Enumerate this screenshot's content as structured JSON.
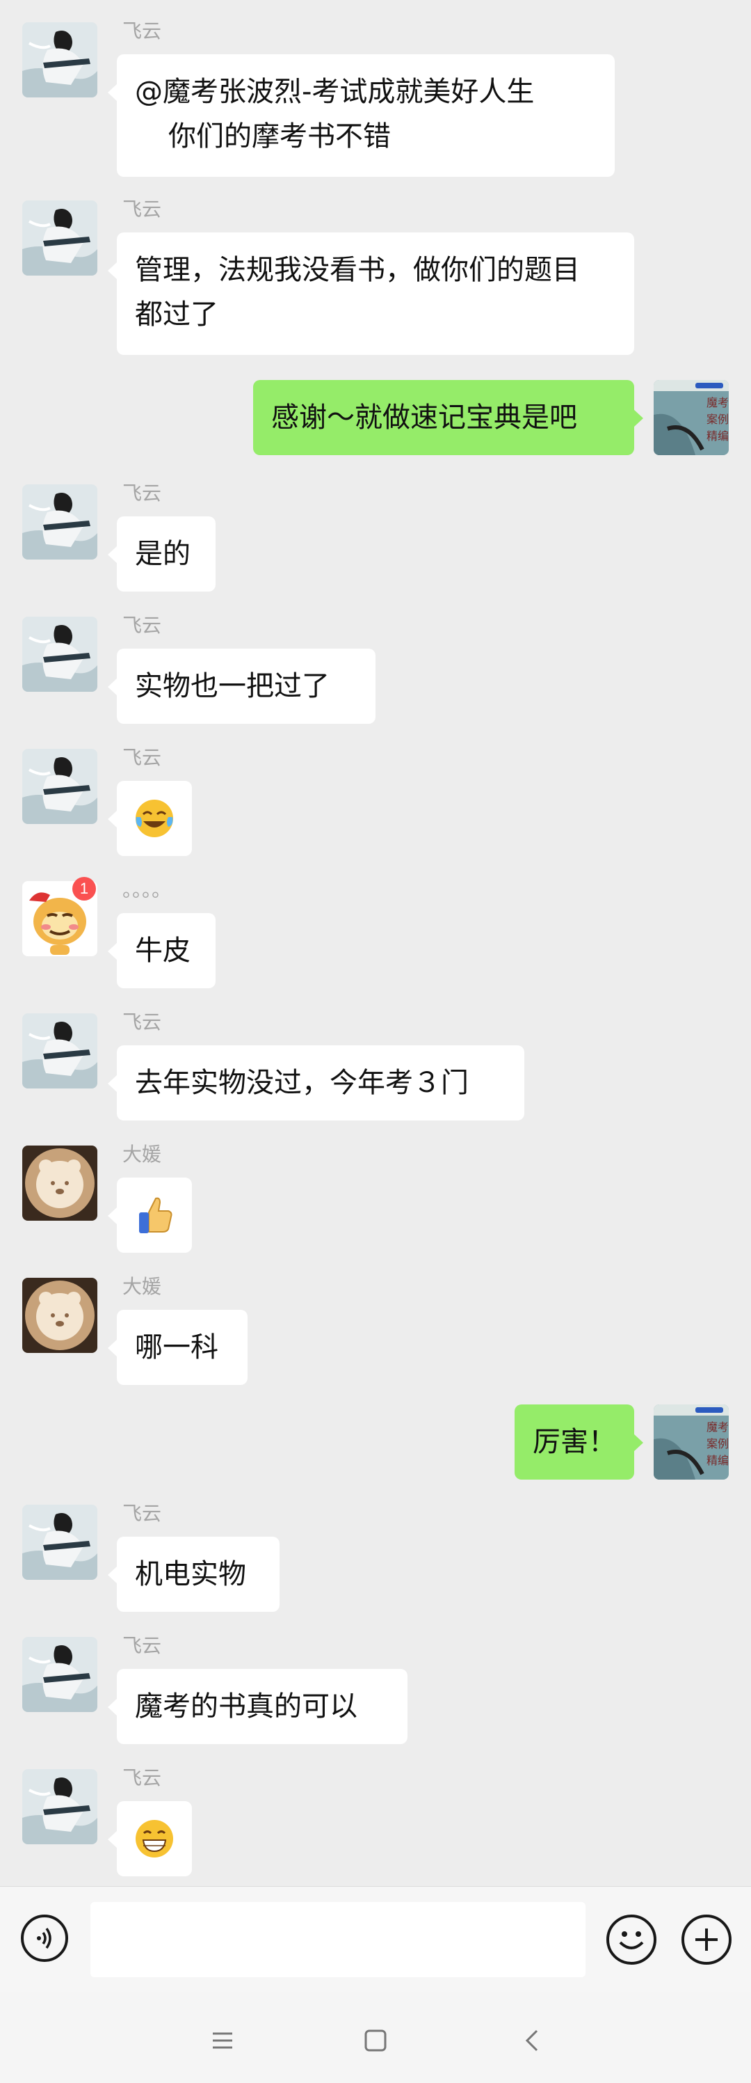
{
  "colors": {
    "background": "#ededed",
    "left_bubble": "#ffffff",
    "right_bubble": "#95ec69",
    "sender_name": "#a5a5a5"
  },
  "messages": [
    {
      "side": "left",
      "sender": "飞云",
      "avatar": "swordsman-avatar",
      "lines": [
        "@魔考张波烈-考试成就美好人生",
        "你们的摩考书不错"
      ]
    },
    {
      "side": "left",
      "sender": "飞云",
      "avatar": "swordsman-avatar",
      "lines": [
        "管理，法规我没看书，做你们的题目",
        "都过了"
      ]
    },
    {
      "side": "right",
      "avatar": "book-cover-avatar",
      "lines": [
        "感谢～就做速记宝典是吧"
      ]
    },
    {
      "side": "left",
      "sender": "飞云",
      "avatar": "swordsman-avatar",
      "lines": [
        "是的"
      ]
    },
    {
      "side": "left",
      "sender": "飞云",
      "avatar": "swordsman-avatar",
      "lines": [
        "实物也一把过了"
      ]
    },
    {
      "side": "left",
      "sender": "飞云",
      "avatar": "swordsman-avatar",
      "emoji": "tears-of-joy-emoji"
    },
    {
      "side": "left",
      "sender": "。。。。",
      "avatar": "monkey-avatar",
      "badge": "1",
      "lines": [
        "牛皮"
      ]
    },
    {
      "side": "left",
      "sender": "飞云",
      "avatar": "swordsman-avatar",
      "lines": [
        "去年实物没过，今年考３门"
      ]
    },
    {
      "side": "left",
      "sender": "大媛",
      "avatar": "latte-art-avatar",
      "emoji": "thumbs-up-emoji"
    },
    {
      "side": "left",
      "sender": "大媛",
      "avatar": "latte-art-avatar",
      "lines": [
        "哪一科"
      ]
    },
    {
      "side": "right",
      "avatar": "book-cover-avatar",
      "lines": [
        "厉害！"
      ]
    },
    {
      "side": "left",
      "sender": "飞云",
      "avatar": "swordsman-avatar",
      "lines": [
        "机电实物"
      ]
    },
    {
      "side": "left",
      "sender": "飞云",
      "avatar": "swordsman-avatar",
      "lines": [
        "魔考的书真的可以"
      ]
    },
    {
      "side": "left",
      "sender": "飞云",
      "avatar": "swordsman-avatar",
      "emoji": "grinning-emoji"
    }
  ],
  "book_cover": {
    "title_chars": [
      "魔",
      "考",
      "案",
      "例",
      "精",
      "编"
    ]
  },
  "input_bar": {
    "voice_icon": "voice-icon",
    "emoji_icon": "emoji-icon",
    "plus_icon": "plus-icon",
    "text_value": ""
  },
  "nav": {
    "menu": "menu-icon",
    "home": "home-icon",
    "back": "back-icon"
  }
}
